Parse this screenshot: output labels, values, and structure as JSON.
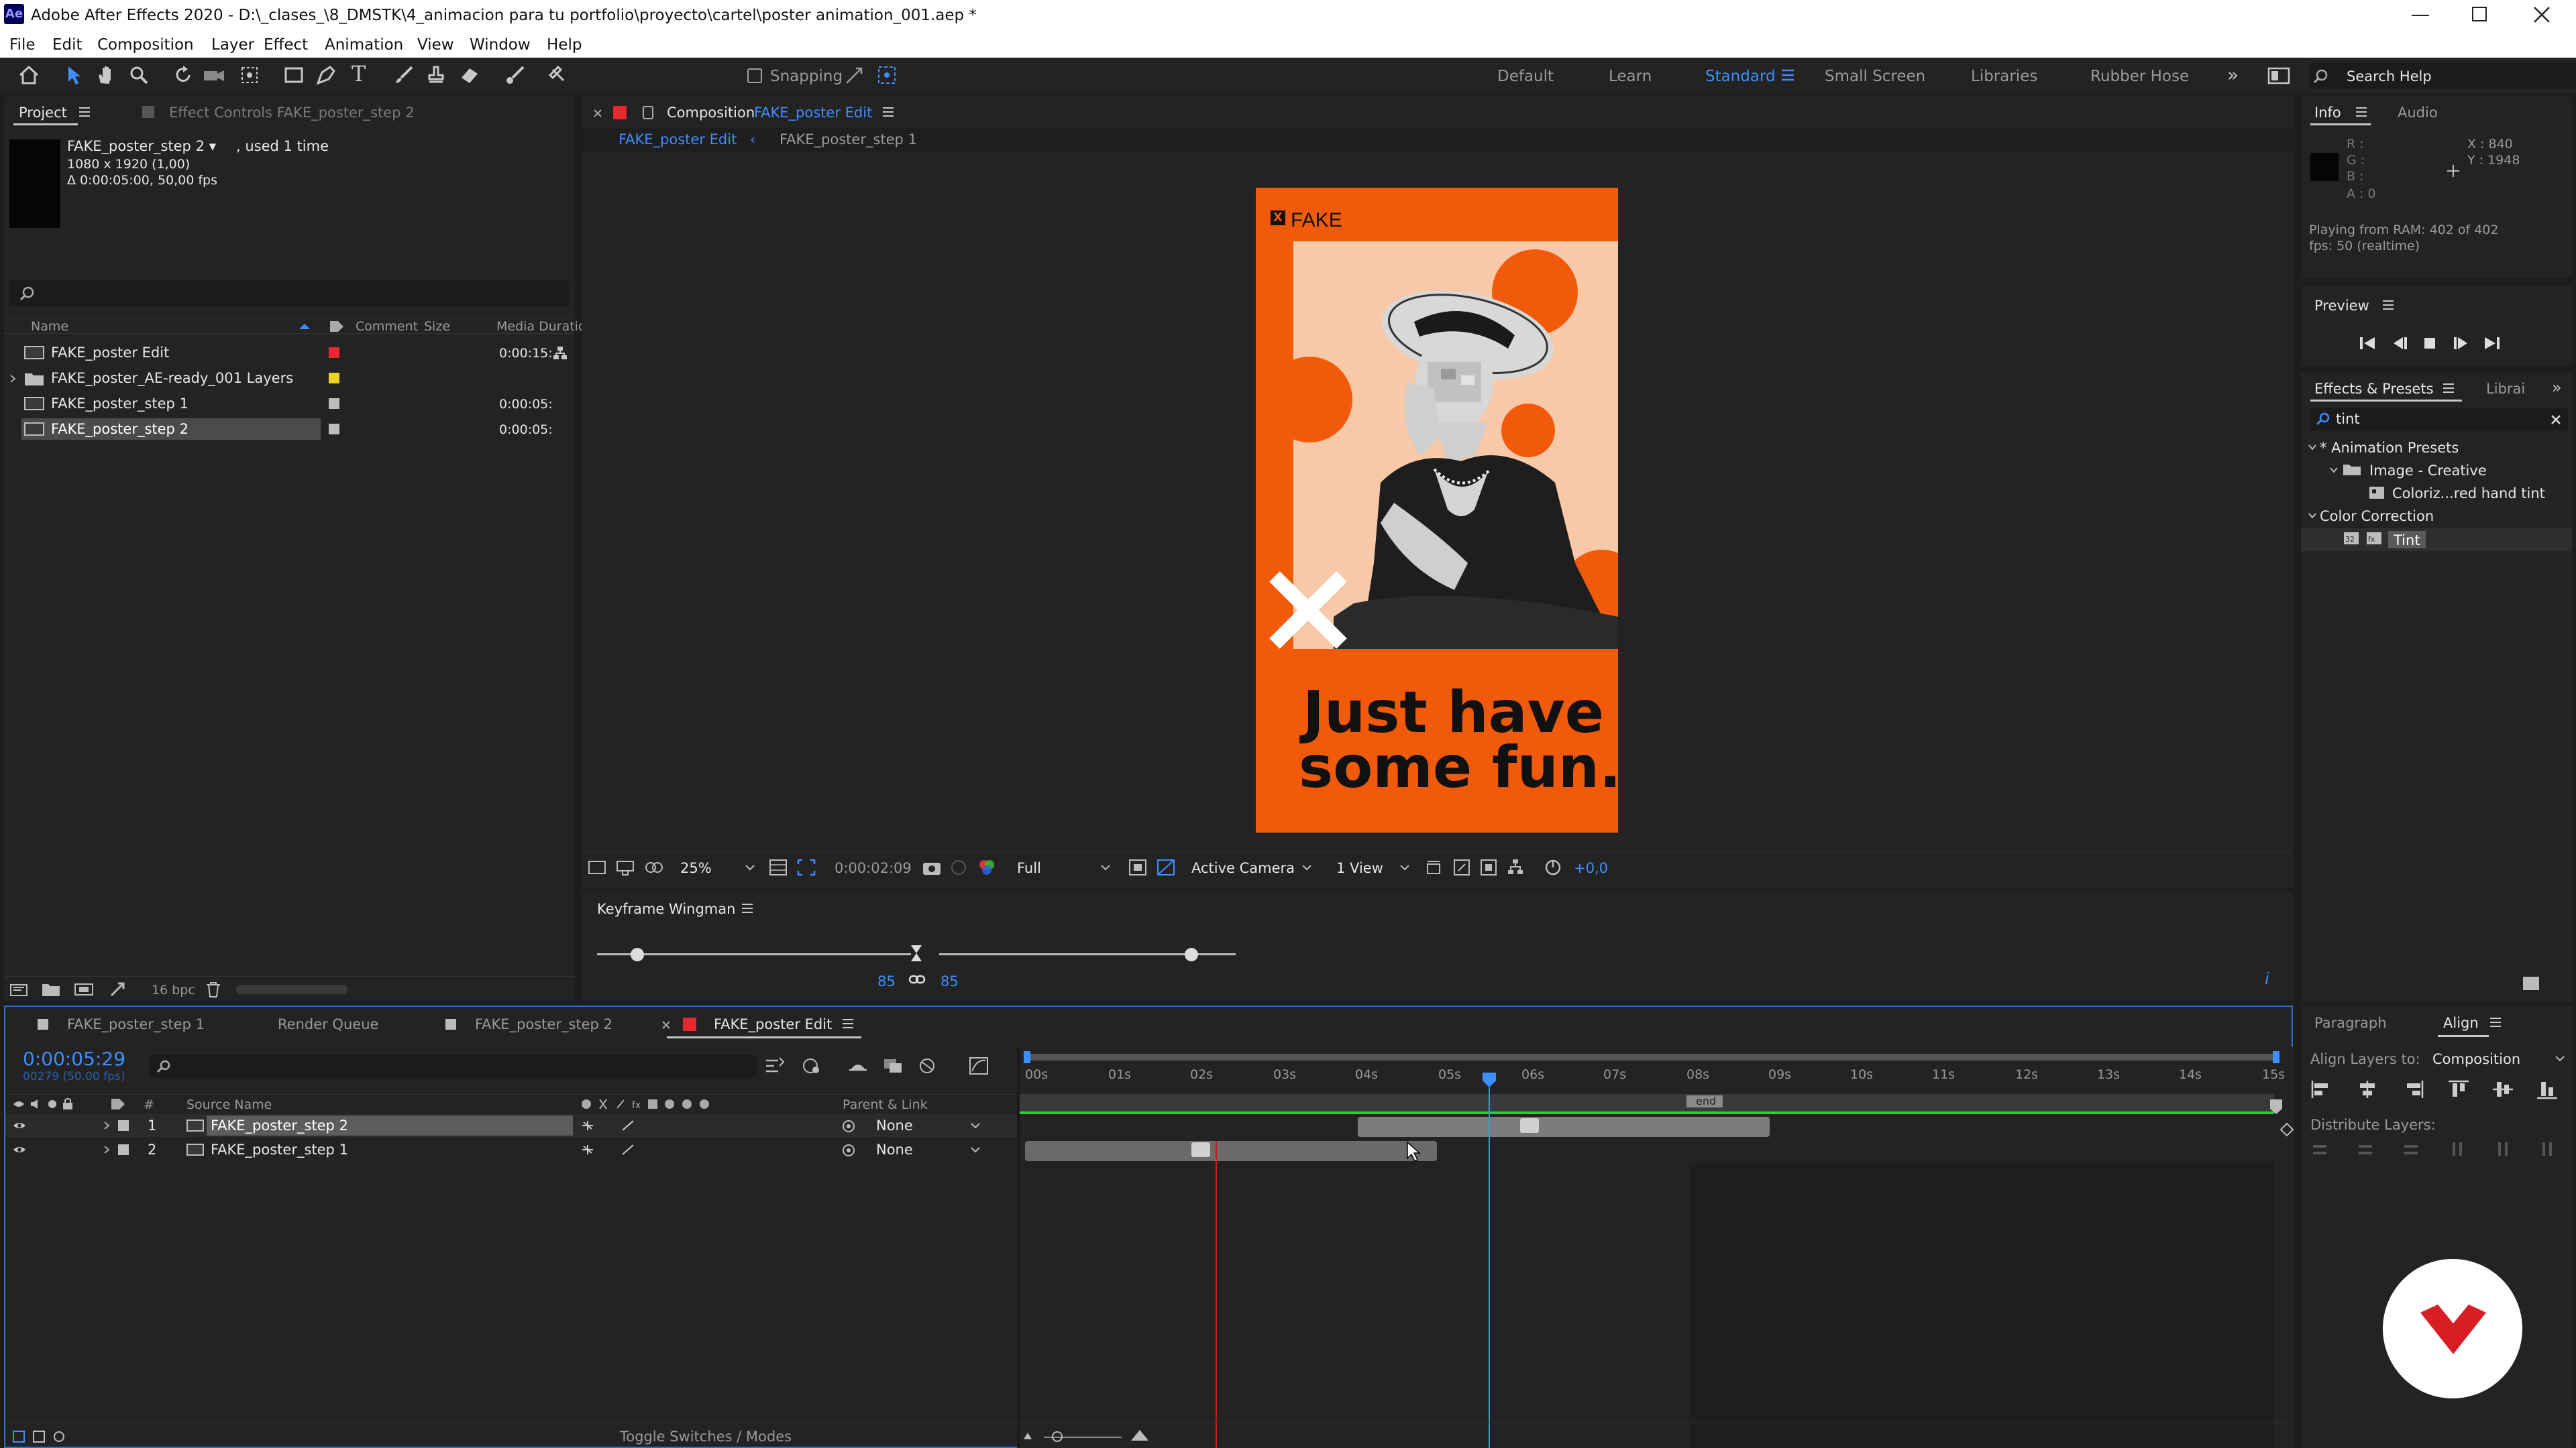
{
  "titlebar": {
    "app_icon": "Ae",
    "title": "Adobe After Effects 2020 - D:\\_clases_\\8_DMSTK\\4_animacion para tu portfolio\\proyecto\\cartel\\poster animation_001.aep *"
  },
  "menu": [
    "File",
    "Edit",
    "Composition",
    "Layer",
    "Effect",
    "Animation",
    "View",
    "Window",
    "Help"
  ],
  "toolbar": {
    "snapping": "Snapping",
    "workspaces": [
      "Default",
      "Learn",
      "Standard",
      "Small Screen",
      "Libraries",
      "Rubber Hose"
    ],
    "active_workspace": "Standard",
    "search_help": "Search Help"
  },
  "project": {
    "tab": "Project",
    "effect_tab": "Effect Controls FAKE_poster_step 2",
    "selected_name": "FAKE_poster_step 2 ▾",
    "used": ", used 1 time",
    "dims": "1080 x 1920 (1,00)",
    "duration": "Δ 0:00:05:00, 50,00 fps",
    "columns": [
      "Name",
      "Comment",
      "Size",
      "Media Duratio"
    ],
    "items": [
      {
        "name": "FAKE_poster Edit",
        "dur": "0:00:15:",
        "color": "#e8282d"
      },
      {
        "name": "FAKE_poster_AE-ready_001 Layers",
        "dur": "",
        "color": "#e8d32a"
      },
      {
        "name": "FAKE_poster_step 1",
        "dur": "0:00:05:",
        "color": "#bdbdbd"
      },
      {
        "name": "FAKE_poster_step 2",
        "dur": "0:00:05:",
        "color": "#bdbdbd"
      }
    ],
    "bpc": "16 bpc"
  },
  "composition": {
    "tab_prefix": "Composition",
    "tab_name": "FAKE_poster Edit",
    "breadcrumb": [
      "FAKE_poster Edit",
      "FAKE_poster_step 1"
    ],
    "zoom": "25%",
    "time": "0:00:02:09",
    "resolution": "Full",
    "camera": "Active Camera",
    "view": "1 View",
    "exposure": "+0,0"
  },
  "poster": {
    "brand": "FAKE",
    "headline_1": "Just have",
    "headline_2": "some fun.",
    "orange": "#f05a0a",
    "peach": "#f8c9a8"
  },
  "wingman": {
    "title": "Keyframe Wingman",
    "left_val": "85",
    "right_val": "85"
  },
  "info": {
    "tab": "Info",
    "audio_tab": "Audio",
    "r": "R :",
    "g": "G :",
    "b": "B :",
    "a": "A : 0",
    "x": "X : 840",
    "y": "Y : 1948",
    "playing": "Playing from RAM: 402 of 402",
    "fps": "fps: 50 (realtime)"
  },
  "preview": {
    "title": "Preview"
  },
  "effects": {
    "tab": "Effects & Presets",
    "lib_tab": "Librai",
    "search": "tint",
    "tree": [
      "* Animation Presets",
      "Image - Creative",
      "Coloriz...red hand tint",
      "Color Correction",
      "Tint"
    ]
  },
  "align": {
    "para_tab": "Paragraph",
    "tab": "Align",
    "align_to_label": "Align Layers to:",
    "align_to": "Composition",
    "distribute": "Distribute Layers:"
  },
  "timeline": {
    "tabs": [
      "FAKE_poster_step 1",
      "Render Queue",
      "FAKE_poster_step 2",
      "FAKE_poster Edit"
    ],
    "timecode": "0:00:05:29",
    "frames": "00279 (50.00 fps)",
    "col_source": "Source Name",
    "col_parent": "Parent & Link",
    "ruler": [
      "00s",
      "01s",
      "02s",
      "03s",
      "04s",
      "05s",
      "06s",
      "07s",
      "08s",
      "09s",
      "10s",
      "11s",
      "12s",
      "13s",
      "14s",
      "15s"
    ],
    "end_marker": "end",
    "layers": [
      {
        "num": "1",
        "name": "FAKE_poster_step 2",
        "parent": "None"
      },
      {
        "num": "2",
        "name": "FAKE_poster_step 1",
        "parent": "None"
      }
    ],
    "toggle": "Toggle Switches / Modes"
  }
}
